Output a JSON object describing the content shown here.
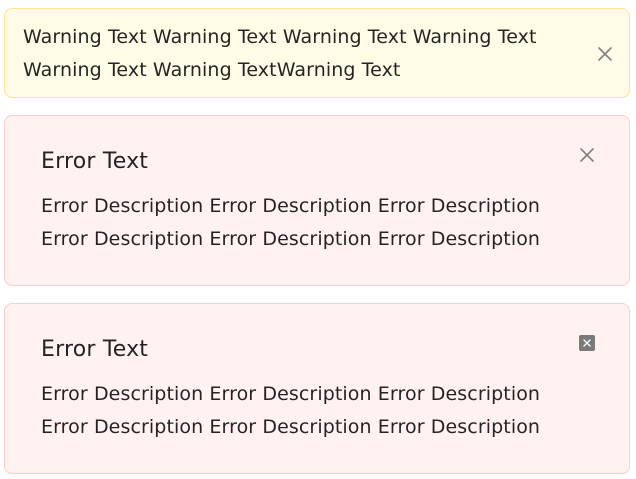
{
  "alerts": {
    "warning": {
      "message": "Warning Text Warning Text Warning Text Warning Text Warning Text Warning TextWarning Text",
      "close_icon": "close-icon",
      "colors": {
        "background": "#fffbe6",
        "border": "#ffe58f"
      }
    },
    "error_1": {
      "title": "Error Text",
      "description": "Error Description Error Description Error Description Error Description Error Description Error Description",
      "close_icon": "close-icon",
      "colors": {
        "background": "#fff2f0",
        "border": "#ffccc7"
      }
    },
    "error_2": {
      "title": "Error Text",
      "description": "Error Description Error Description Error Description Error Description Error Description Error Description",
      "close_icon": "close-square-icon",
      "colors": {
        "background": "#fff2f0",
        "border": "#ffccc7"
      }
    }
  }
}
